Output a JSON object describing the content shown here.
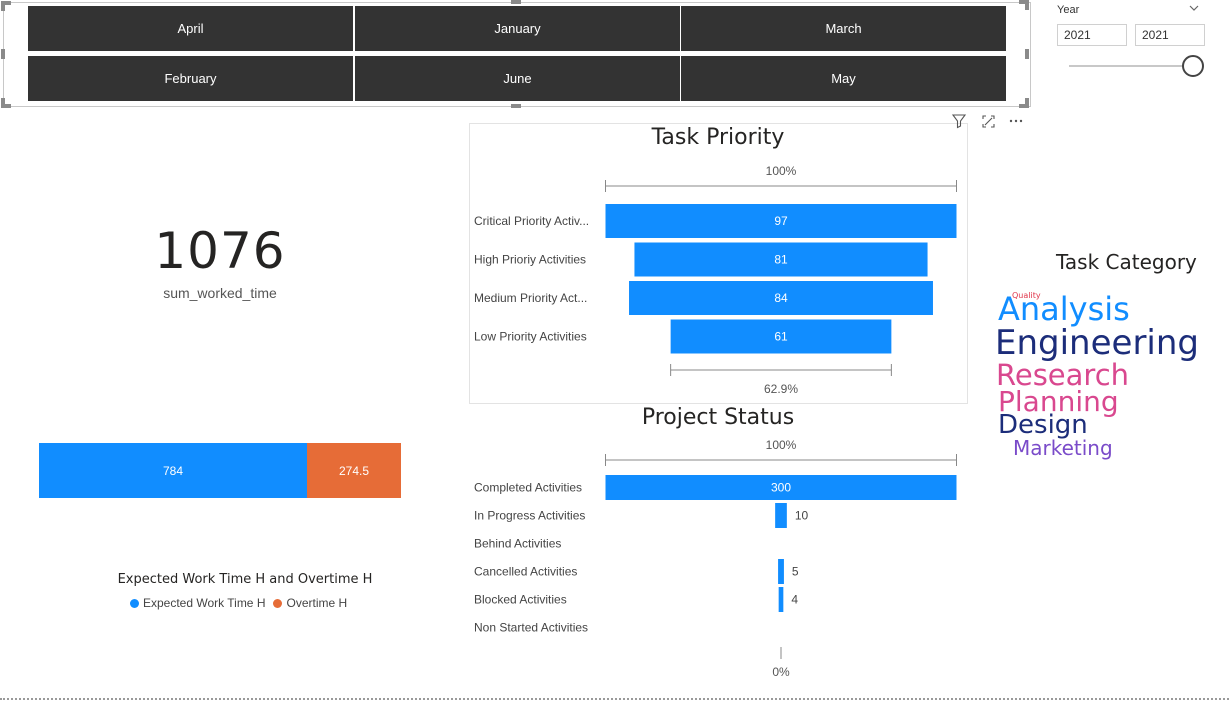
{
  "month_slicer": {
    "months": [
      "April",
      "January",
      "March",
      "February",
      "June",
      "May"
    ]
  },
  "year_slicer": {
    "label": "Year",
    "from": "2021",
    "to": "2021",
    "icons": {
      "dropdown": "chevron-down-icon"
    }
  },
  "kpi": {
    "value": "1076",
    "label": "sum_worked_time"
  },
  "work_time_chart": {
    "title": "Expected Work Time H and Overtime H",
    "legend": [
      "Expected Work Time H",
      "Overtime H"
    ],
    "colors": {
      "expected": "#118DFF",
      "overtime": "#E66C37"
    },
    "expected_label": "784",
    "overtime_label": "274.5"
  },
  "visual_header": {
    "icons": [
      "filter-icon",
      "focus-mode-icon",
      "more-options-icon"
    ]
  },
  "task_category": {
    "title": "Task Category",
    "words": [
      "Quality",
      "Analysis",
      "Engineering",
      "Research",
      "Planning",
      "Design",
      "Marketing"
    ]
  },
  "chart_data": [
    {
      "type": "bar",
      "subtype": "funnel",
      "title": "Task Priority",
      "categories": [
        "Critical Priority Activ...",
        "High Prioriy Activities",
        "Medium Priority Act...",
        "Low Priority Activities"
      ],
      "values": [
        97,
        81,
        84,
        61
      ],
      "value_labels": [
        "97",
        "81",
        "84",
        "61"
      ],
      "top_percent": "100%",
      "bottom_percent": "62.9%",
      "color": "#118DFF"
    },
    {
      "type": "bar",
      "subtype": "funnel",
      "title": "Project Status",
      "categories": [
        "Completed Activities",
        "In Progress Activities",
        "Behind Activities",
        "Cancelled Activities",
        "Blocked Activities",
        "Non Started Activities"
      ],
      "values": [
        300,
        10,
        0,
        5,
        4,
        0
      ],
      "value_labels": [
        "300",
        "10",
        "",
        "5",
        "4",
        ""
      ],
      "top_percent": "100%",
      "bottom_percent": "0%",
      "color": "#118DFF"
    },
    {
      "type": "bar",
      "subtype": "stacked",
      "title": "Expected Work Time H and Overtime H",
      "series": [
        {
          "name": "Expected Work Time H",
          "values": [
            784
          ]
        },
        {
          "name": "Overtime H",
          "values": [
            274.5
          ]
        }
      ]
    }
  ]
}
